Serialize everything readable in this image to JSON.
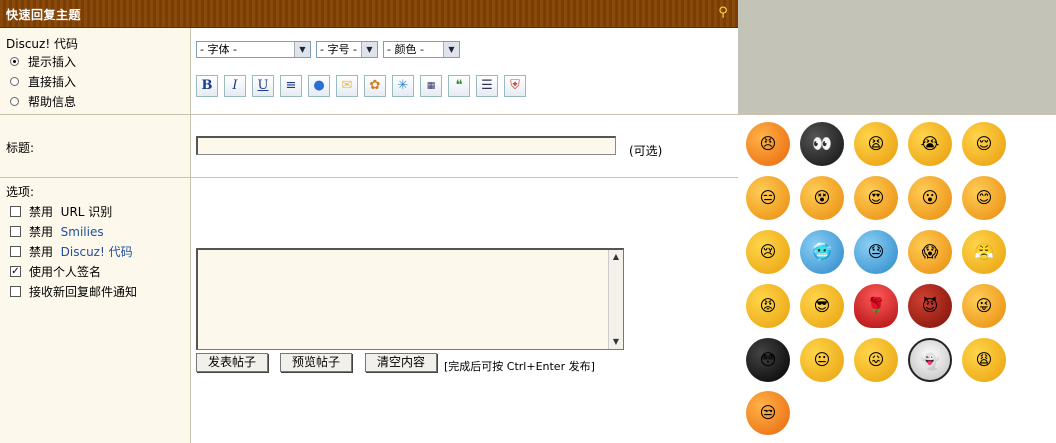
{
  "header": {
    "title": "快速回复主题",
    "collapse_icon": "collapse-icon"
  },
  "code_section": {
    "title": "Discuz! 代码",
    "modes": [
      {
        "label": "提示插入",
        "checked": true
      },
      {
        "label": "直接插入",
        "checked": false
      },
      {
        "label": "帮助信息",
        "checked": false
      }
    ]
  },
  "toolbar": {
    "font_select": "- 字体 -",
    "size_select": "- 字号 -",
    "color_select": "- 颜色 -",
    "icons": [
      "B",
      "I",
      "U"
    ]
  },
  "subject": {
    "label": "标题:",
    "optional_text": "(可选)"
  },
  "options": {
    "label": "选项:",
    "items": [
      {
        "prefix": "禁用",
        "term": "URL 识别",
        "checked": false
      },
      {
        "prefix": "禁用",
        "term": "Smilies",
        "checked": false
      },
      {
        "prefix": "禁用",
        "term": "Discuz! 代码",
        "checked": false
      },
      {
        "prefix": "使用个人签名",
        "term": "",
        "checked": true
      },
      {
        "prefix": "接收新回复邮件通知",
        "term": "",
        "checked": false
      }
    ]
  },
  "actions": {
    "submit": "发表帖子",
    "preview": "预览帖子",
    "clear": "清空内容",
    "hint": "[完成后可按 Ctrl+Enter 发布]"
  }
}
